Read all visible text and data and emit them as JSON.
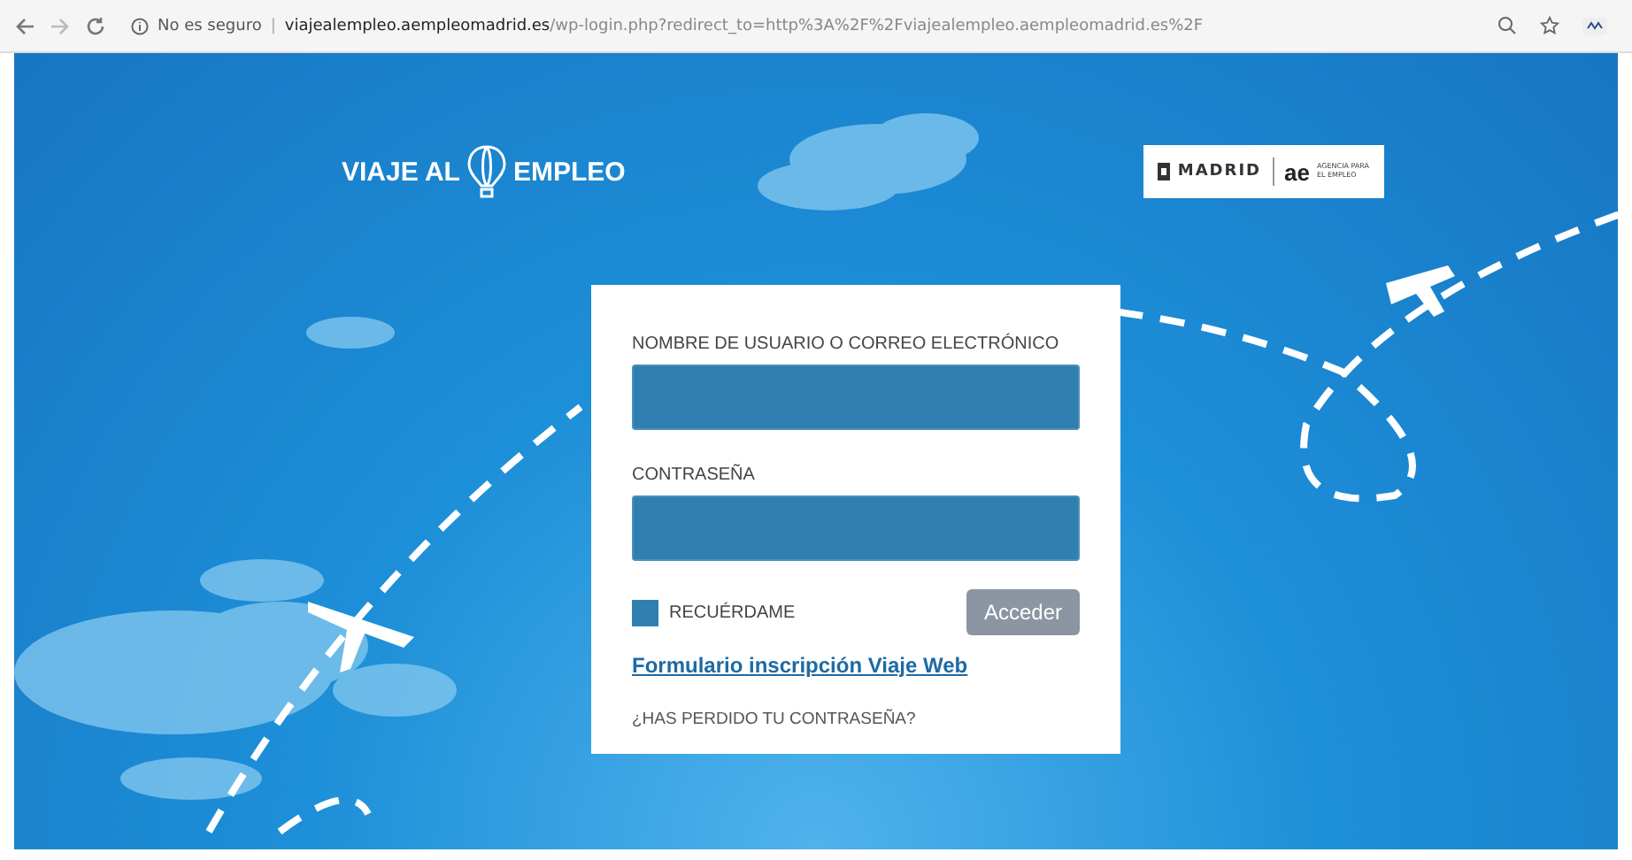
{
  "browser": {
    "security": "No es seguro",
    "separator": "|",
    "url_host": "viajealempleo.aempleomadrid.es",
    "url_path": "/wp-login.php?redirect_to=http%3A%2F%2Fviajealempleo.aempleomadrid.es%2F"
  },
  "header": {
    "logo_left": "VIAJE AL",
    "logo_right": "EMPLEO",
    "partner_city": "MADRID",
    "partner_mark": "ae",
    "partner_agency": "AGENCIA PARA EL EMPLEO"
  },
  "login": {
    "username_label": "NOMBRE DE USUARIO O CORREO ELECTRÓNICO",
    "password_label": "CONTRASEÑA",
    "remember": {
      "label": "RECUÉRDAME",
      "checked": false
    },
    "submit": "Acceder",
    "signup_link": "Formulario inscripción Viaje Web",
    "lost_password": "¿HAS PERDIDO TU CONTRASEÑA?"
  }
}
